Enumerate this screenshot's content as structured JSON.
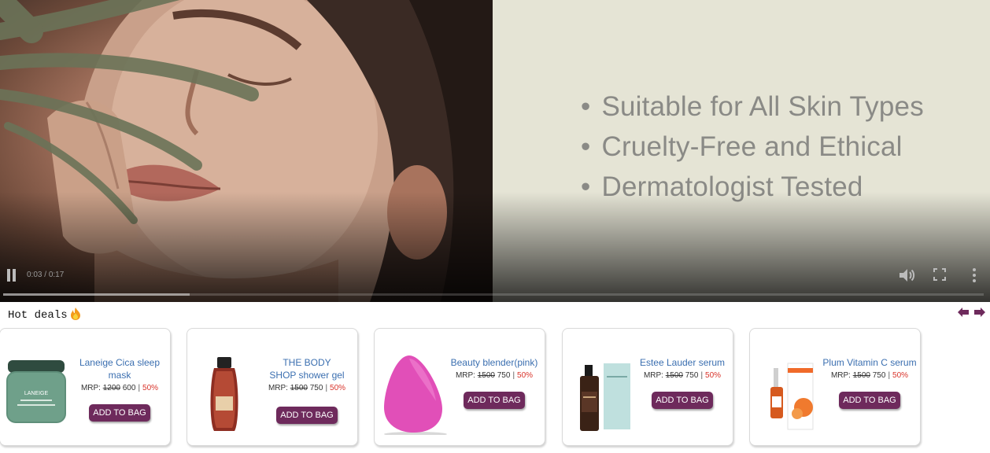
{
  "video": {
    "bullets": [
      "Suitable for All Skin Types",
      "Cruelty-Free and Ethical",
      "Dermatologist Tested"
    ],
    "time_current": "0:03",
    "time_total": "0:17",
    "progress": 0.19
  },
  "deals": {
    "title": "Hot deals",
    "icons": {
      "title": "fire-icon",
      "prev": "arrow-left-icon",
      "next": "arrow-right-icon"
    },
    "mrp_label": "MRP:",
    "products": [
      {
        "name": "Laneige Cica sleep mask",
        "mrp": "1200",
        "price": "600",
        "discount": "50%",
        "button": "ADD TO BAG"
      },
      {
        "name": "THE BODY SHOP shower gel",
        "mrp": "1500",
        "price": "750",
        "discount": "50%",
        "button": "ADD TO BAG"
      },
      {
        "name": "Beauty blender(pink)",
        "mrp": "1500",
        "price": "750",
        "discount": "50%",
        "button": "ADD TO BAG"
      },
      {
        "name": "Estee Lauder serum",
        "mrp": "1500",
        "price": "750",
        "discount": "50%",
        "button": "ADD TO BAG"
      },
      {
        "name": "Plum Vitamin C serum",
        "mrp": "1500",
        "price": "750",
        "discount": "50%",
        "button": "ADD TO BAG"
      }
    ]
  },
  "colors": {
    "button": "#6e2a5c",
    "discount": "#d9342b",
    "product_name": "#3b6fb0",
    "arrows": "#6e2a5c"
  }
}
